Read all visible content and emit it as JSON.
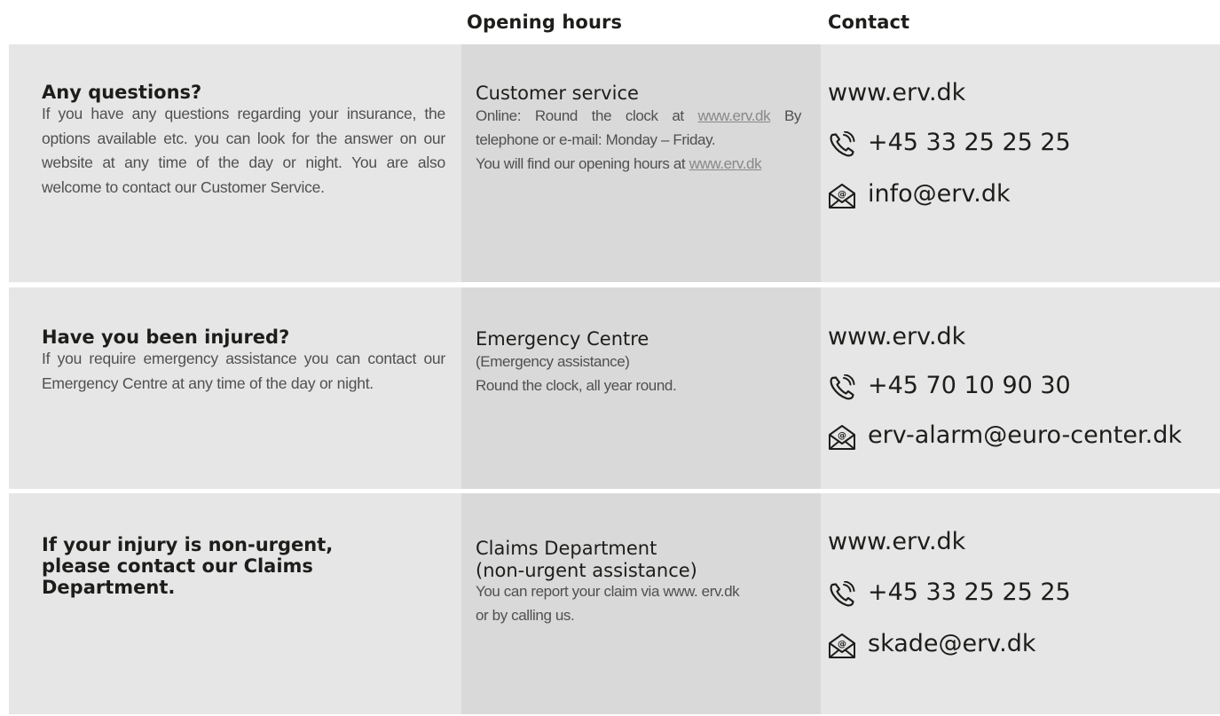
{
  "header": {
    "opening_hours": "Opening hours",
    "contact": "Contact"
  },
  "rows": [
    {
      "title": "Any questions?",
      "description": "If you have any questions regarding your insurance, the options available etc. you can look for the answer on our website at any time of the day or night. You are also welcome to contact our Customer Service.",
      "service_name": "Customer service",
      "service_text_1": "Online: Round the clock at",
      "service_link_1": "www.erv.dk",
      "service_text_2": "By telephone or e-mail: Monday – Friday.",
      "service_text_3": "You will find our opening hours at",
      "service_link_2": "www.erv.dk",
      "website": "www.erv.dk",
      "phone": "+45 33 25 25 25",
      "email": "info@erv.dk"
    },
    {
      "title": "Have you been injured?",
      "description": "If you require emergency assistance you can contact our Emergency Centre at any time of the day or night.",
      "service_name": "Emergency Centre",
      "service_subtitle": "(Emergency assistance)",
      "service_text": "Round the clock, all year round.",
      "website": "www.erv.dk",
      "phone": "+45 70 10 90 30",
      "email": "erv-alarm@euro-center.dk"
    },
    {
      "title": "If your injury is non-urgent, please contact our Claims Department.",
      "service_name": "Claims Department",
      "service_subtitle": "(non-urgent assistance)",
      "service_text": "You can report your claim via www. erv.dk or by calling us.",
      "website": "www.erv.dk",
      "phone": "+45 33 25 25 25",
      "email": "skade@erv.dk"
    }
  ],
  "icons": {
    "phone": "phone-icon",
    "email": "email-icon"
  },
  "colors": {
    "band": "#e6e6e6",
    "middle_column": "#d9d9d9",
    "text_dark": "#1d1d1b",
    "text_body": "#505050",
    "link": "#888888"
  }
}
